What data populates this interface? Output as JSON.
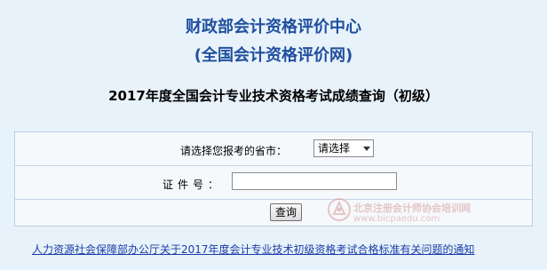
{
  "header": {
    "title_line1": "财政部会计资格评价中心",
    "title_line2": "(全国会计资格评价网)"
  },
  "query_title": "2017年度全国会计专业技术资格考试成绩查询（初级）",
  "form": {
    "province_label": "请选择您报考的省市：",
    "province_select_value": "请选择",
    "id_label": "证件号：",
    "id_value": "",
    "query_button": "查询"
  },
  "notice_link": "人力资源社会保障部办公厅关于2017年度会计专业技术初级资格考试合格标准有关问题的通知",
  "watermark": {
    "text_cn": "北京注册会计师协会培训网",
    "text_url": "www.bicpaedu.com",
    "icon": "seal-logo-icon"
  },
  "colors": {
    "background": "#e8f2fa",
    "header_blue": "#1f4f9e",
    "link_blue": "#1a3ea8",
    "watermark_red": "#d79a9a"
  }
}
